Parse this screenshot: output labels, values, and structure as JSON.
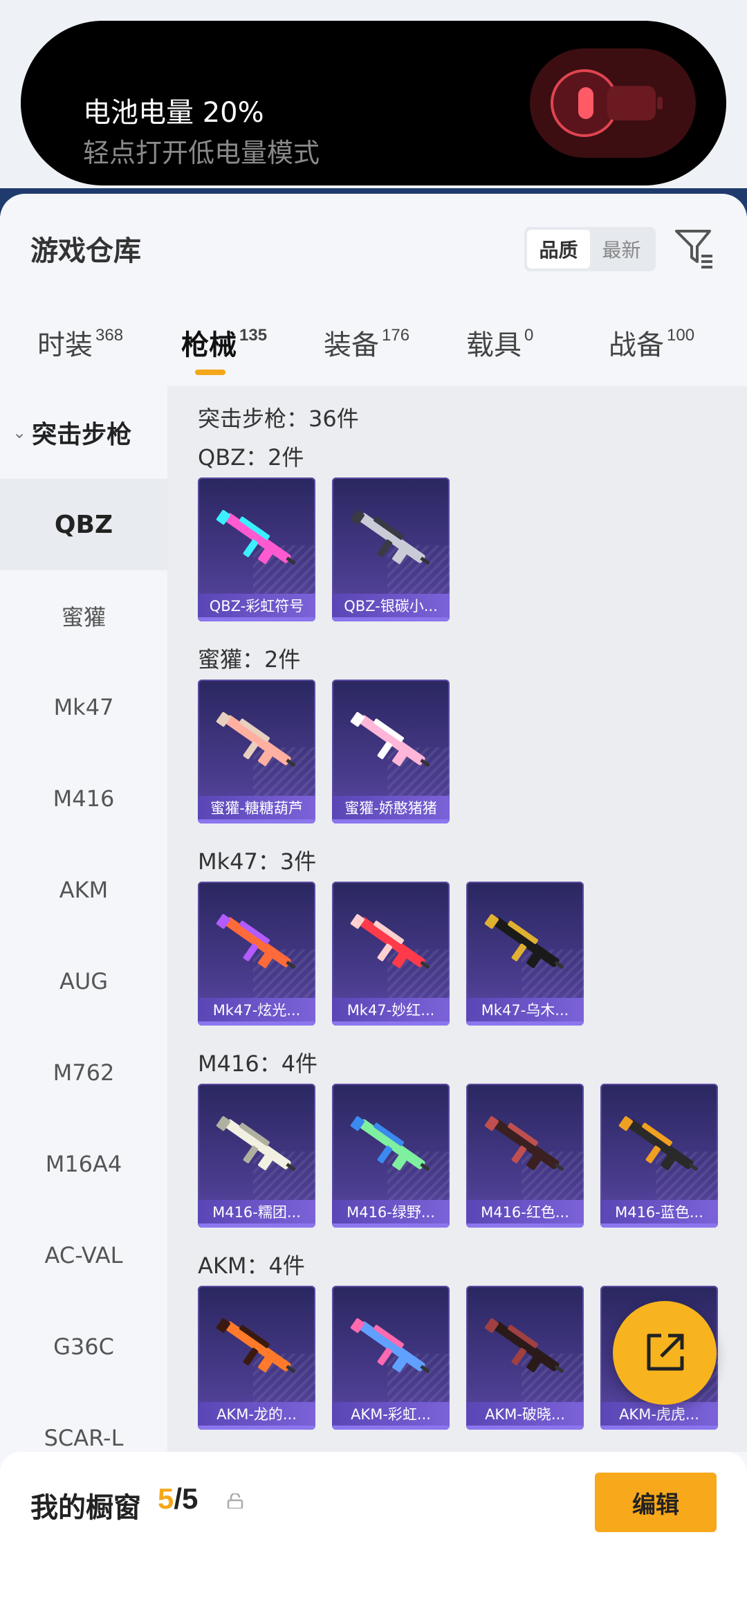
{
  "notification": {
    "title": "电池电量 20%",
    "subtitle": "轻点打开低电量模式",
    "icon": "battery-low-icon"
  },
  "header": {
    "title": "游戏仓库",
    "sort_options": [
      "品质",
      "最新"
    ],
    "sort_active": "品质",
    "filter_icon": "filter-icon"
  },
  "tabs": [
    {
      "label": "时装",
      "count": "368"
    },
    {
      "label": "枪械",
      "count": "135"
    },
    {
      "label": "装备",
      "count": "176"
    },
    {
      "label": "载具",
      "count": "0"
    },
    {
      "label": "战备",
      "count": "100"
    }
  ],
  "active_tab": "枪械",
  "sidebar": {
    "category": "突击步枪",
    "items": [
      "QBZ",
      "蜜獾",
      "Mk47",
      "M416",
      "AKM",
      "AUG",
      "M762",
      "M16A4",
      "AC-VAL",
      "G36C",
      "SCAR-L"
    ],
    "active": "QBZ"
  },
  "content": {
    "summary": "突击步枪：36件",
    "groups": [
      {
        "title": "QBZ：2件",
        "items": [
          "QBZ-彩虹符号",
          "QBZ-银碳小..."
        ]
      },
      {
        "title": "蜜獾：2件",
        "items": [
          "蜜獾-糖糖葫芦",
          "蜜獾-娇憨猪猪"
        ]
      },
      {
        "title": "Mk47：3件",
        "items": [
          "Mk47-炫光...",
          "Mk47-妙红...",
          "Mk47-乌木..."
        ]
      },
      {
        "title": "M416：4件",
        "items": [
          "M416-糯团...",
          "M416-绿野...",
          "M416-红色...",
          "M416-蓝色..."
        ]
      },
      {
        "title": "AKM：4件",
        "items": [
          "AKM-龙的...",
          "AKM-彩虹...",
          "AKM-破晓...",
          "AKM-虎虎..."
        ]
      }
    ]
  },
  "fab": {
    "icon": "share-external-icon"
  },
  "bottom_bar": {
    "label": "我的橱窗",
    "current": "5",
    "total": "/5",
    "lock_icon": "lock-icon",
    "edit_label": "编辑"
  },
  "colors": {
    "accent": "#f7a81b",
    "card_bg": "#3a3278",
    "card_label": "#6b55c8"
  }
}
